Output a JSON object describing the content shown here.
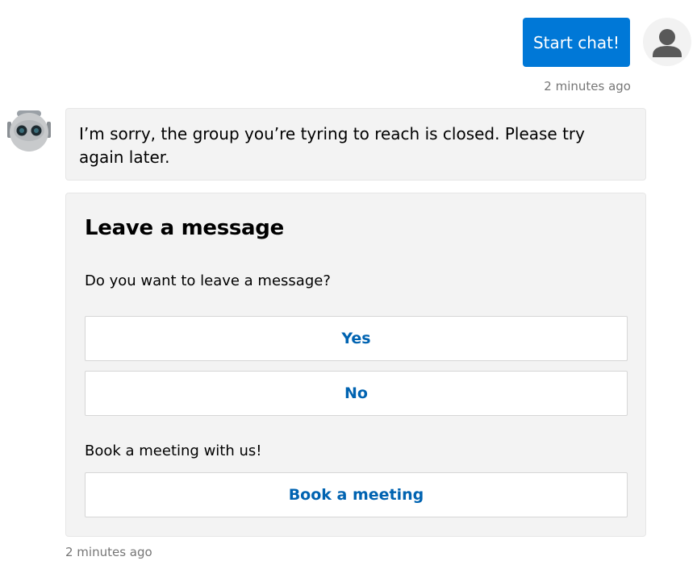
{
  "user_message": {
    "text": "Start chat!",
    "timestamp": "2 minutes ago",
    "avatar_icon": "person-icon",
    "bubble_color": "#0078d7"
  },
  "bot_message": {
    "avatar_icon": "robot-icon",
    "text": "I’m sorry, the group you’re tyring to reach is closed. Please try again later.",
    "timestamp": "2 minutes ago"
  },
  "card": {
    "title": "Leave a message",
    "question": "Do you want to leave a message?",
    "yes_label": "Yes",
    "no_label": "No",
    "meeting_prompt": "Book a meeting with us!",
    "book_label": "Book a meeting",
    "action_color": "#0063b1"
  }
}
